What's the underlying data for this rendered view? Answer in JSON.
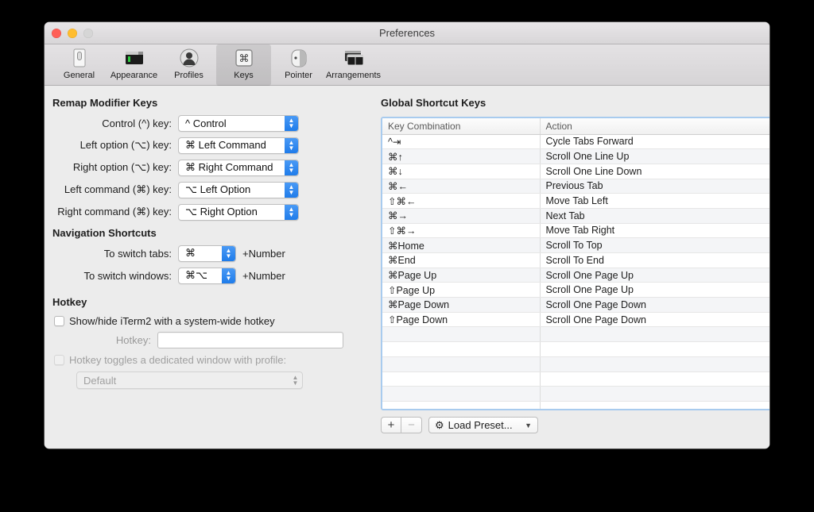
{
  "window": {
    "title": "Preferences",
    "traffic_lights": [
      "close-button",
      "minimize-button",
      "zoom-button"
    ]
  },
  "toolbar": {
    "items": [
      {
        "label": "General",
        "icon": "general-icon",
        "selected": false
      },
      {
        "label": "Appearance",
        "icon": "appearance-icon",
        "selected": false
      },
      {
        "label": "Profiles",
        "icon": "profiles-icon",
        "selected": false
      },
      {
        "label": "Keys",
        "icon": "keys-icon",
        "selected": true
      },
      {
        "label": "Pointer",
        "icon": "pointer-icon",
        "selected": false
      },
      {
        "label": "Arrangements",
        "icon": "arrangements-icon",
        "selected": false
      }
    ]
  },
  "remap": {
    "title": "Remap Modifier Keys",
    "rows": [
      {
        "label": "Control (^) key:",
        "value": "^ Control"
      },
      {
        "label": "Left option (⌥) key:",
        "value": "⌘ Left Command"
      },
      {
        "label": "Right option (⌥) key:",
        "value": "⌘ Right Command"
      },
      {
        "label": "Left command (⌘) key:",
        "value": "⌥ Left Option"
      },
      {
        "label": "Right command (⌘) key:",
        "value": "⌥ Right Option"
      }
    ]
  },
  "navigation": {
    "title": "Navigation Shortcuts",
    "rows": [
      {
        "label": "To switch tabs:",
        "value": "⌘",
        "suffix": "+Number"
      },
      {
        "label": "To switch windows:",
        "value": "⌘⌥",
        "suffix": "+Number"
      }
    ]
  },
  "hotkey": {
    "title": "Hotkey",
    "enable_label": "Show/hide iTerm2 with a system-wide hotkey",
    "enable_checked": false,
    "field_label": "Hotkey:",
    "field_value": "",
    "field_placeholder": "",
    "dedicated_label": "Hotkey toggles a dedicated window with profile:",
    "dedicated_checked": false,
    "dedicated_disabled": true,
    "profile_value": "Default"
  },
  "global_shortcuts": {
    "title": "Global Shortcut Keys",
    "columns": [
      "Key Combination",
      "Action"
    ],
    "rows": [
      {
        "key": "^⇥",
        "action": "Cycle Tabs Forward"
      },
      {
        "key": "⌘↑",
        "action": "Scroll One Line Up"
      },
      {
        "key": "⌘↓",
        "action": "Scroll One Line Down"
      },
      {
        "key": "⌘←",
        "action": "Previous Tab"
      },
      {
        "key": "⇧⌘←",
        "action": "Move Tab Left"
      },
      {
        "key": "⌘→",
        "action": "Next Tab"
      },
      {
        "key": "⇧⌘→",
        "action": "Move Tab Right"
      },
      {
        "key": "⌘Home",
        "action": "Scroll To Top"
      },
      {
        "key": "⌘End",
        "action": "Scroll To End"
      },
      {
        "key": "⌘Page Up",
        "action": "Scroll One Page Up"
      },
      {
        "key": "⇧Page Up",
        "action": "Scroll One Page Up"
      },
      {
        "key": "⌘Page Down",
        "action": "Scroll One Page Down"
      },
      {
        "key": "⇧Page Down",
        "action": "Scroll One Page Down"
      },
      {
        "key": "",
        "action": ""
      },
      {
        "key": "",
        "action": ""
      },
      {
        "key": "",
        "action": ""
      },
      {
        "key": "",
        "action": ""
      },
      {
        "key": "",
        "action": ""
      },
      {
        "key": "",
        "action": ""
      }
    ]
  },
  "bottom_bar": {
    "add_label": "+",
    "remove_label": "−",
    "preset_label": "Load Preset...",
    "preset_icon": "gear-icon",
    "chevron_icon": "chevron-down-icon"
  },
  "colors": {
    "accent_blue": "#1f7cea",
    "focus_ring": "#a8cbee",
    "window_bg": "#ececec"
  }
}
